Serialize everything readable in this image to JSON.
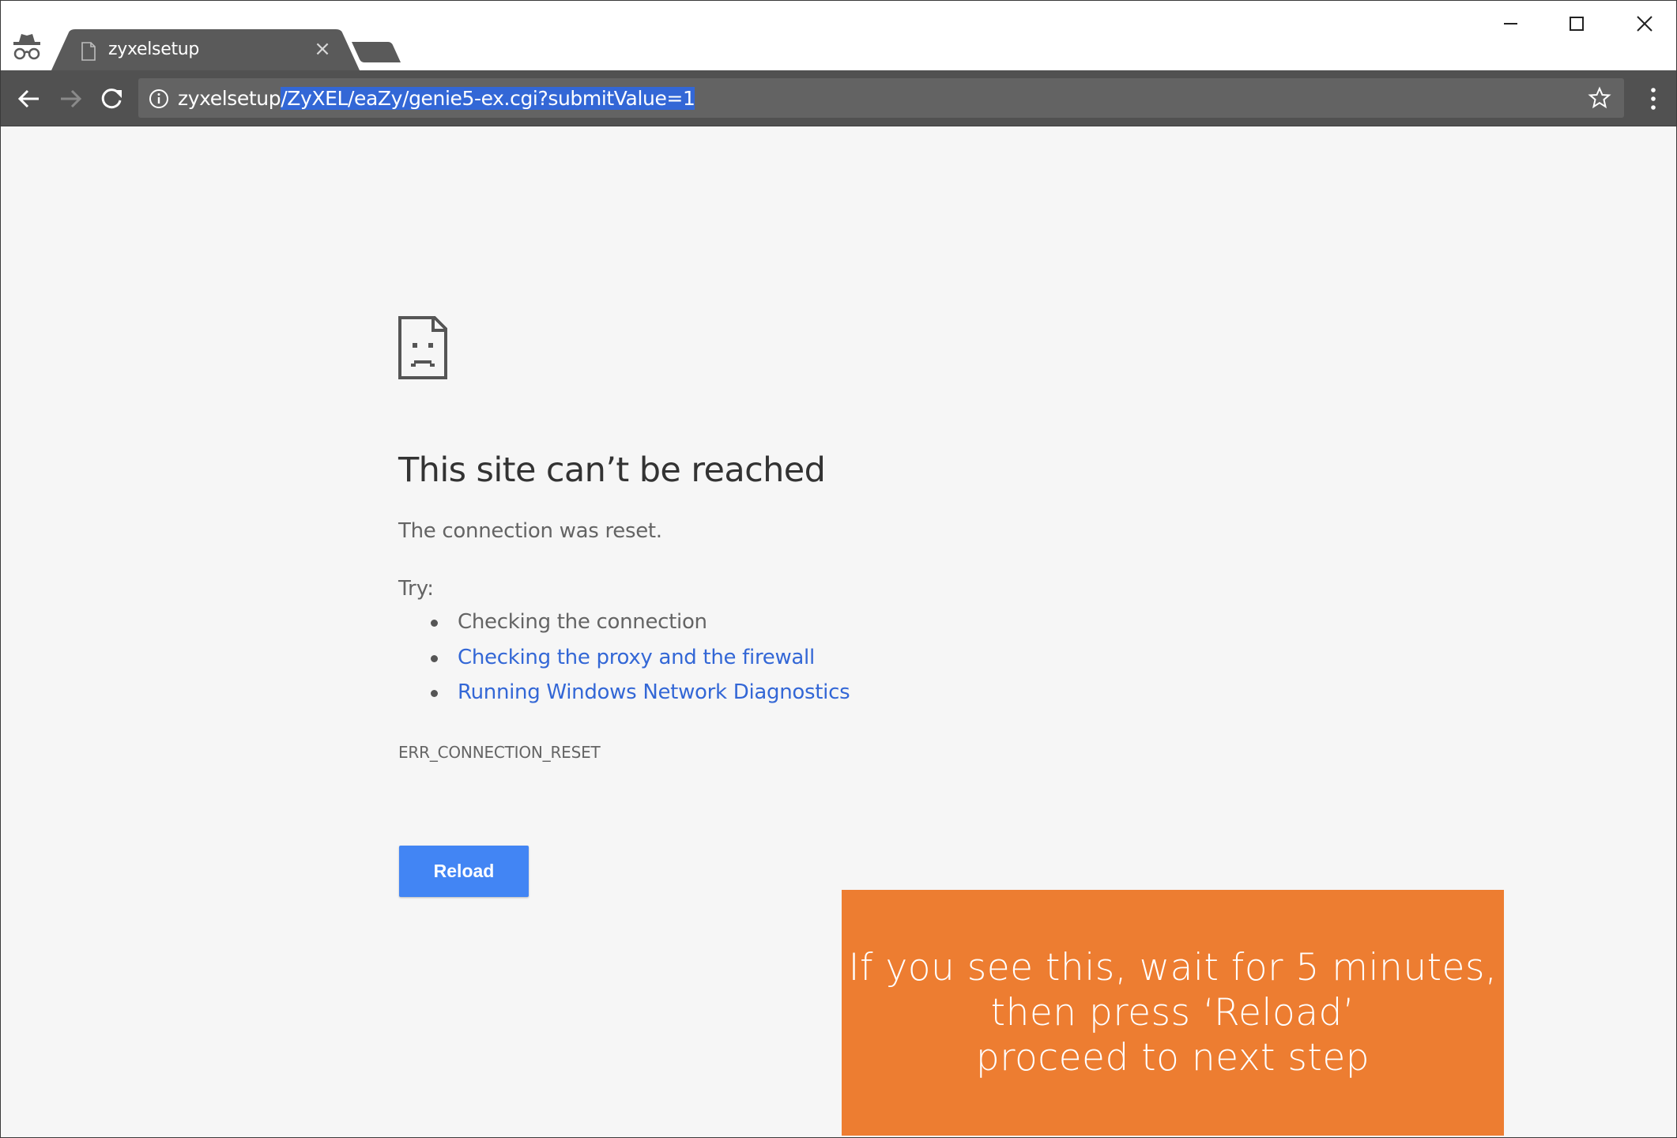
{
  "window": {
    "title_bar": {
      "incognito_icon": "incognito-icon",
      "tab": {
        "title": "zyxelsetup",
        "favicon": "page-icon",
        "close_symbol": "×"
      },
      "new_tab_icon": "new-tab-icon",
      "controls": [
        "minimize-icon",
        "maximize-icon",
        "close-icon"
      ]
    },
    "toolbar": {
      "back_icon": "arrow-left-icon",
      "forward_icon": "arrow-right-icon",
      "reload_icon": "reload-icon",
      "address": {
        "host": "zyxelsetup",
        "path_selected": "/ZyXEL/eaZy/genie5-ex.cgi?submitValue=1",
        "info_icon": "info-icon"
      },
      "bookmark_icon": "star-icon",
      "menu_icon": "more-vertical-icon"
    }
  },
  "error_page": {
    "icon": "sad-document-icon",
    "title": "This site can’t be reached",
    "description": "The connection was reset.",
    "try_label": "Try:",
    "suggestions": [
      {
        "text": "Checking the connection",
        "is_link": false
      },
      {
        "text": "Checking the proxy and the firewall",
        "is_link": true
      },
      {
        "text": "Running Windows Network Diagnostics",
        "is_link": true
      }
    ],
    "error_code": "ERR_CONNECTION_RESET",
    "reload_button": "Reload"
  },
  "callout": {
    "lines": [
      "If you see this, wait for 5 minutes,",
      "then press ‘Reload’",
      "proceed to next step"
    ]
  },
  "colors": {
    "tab_background": "#5a5a5a",
    "toolbar": "#515151",
    "omnibox": "#636363",
    "selection": "#3367d6",
    "link": "#3367d6",
    "button": "#4285f4",
    "callout": "#ed7d31",
    "page_background": "#f6f6f6"
  }
}
